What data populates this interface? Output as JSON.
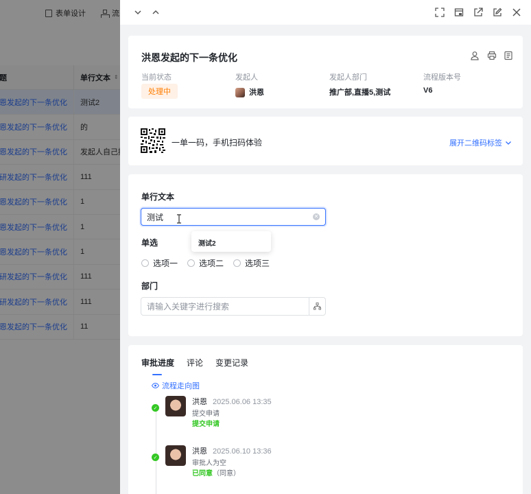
{
  "background": {
    "toolbar": {
      "form_design": "表单设计",
      "flow_partial": "流"
    },
    "table": {
      "col_title": "标题",
      "col_text": "单行文本",
      "rows": [
        {
          "title": "洪恩发起的下一条优化",
          "text": "测试2"
        },
        {
          "title": "洪恩发起的下一条优化",
          "text": "的"
        },
        {
          "title": "洪恩发起的下一条优化",
          "text": "发起人自己撤"
        },
        {
          "title": "钱研发起的下一条优化",
          "text": "111"
        },
        {
          "title": "洪恩发起的下一条优化",
          "text": "1"
        },
        {
          "title": "洪恩发起的下一条优化",
          "text": "1"
        },
        {
          "title": "洪恩发起的下一条优化",
          "text": "1"
        },
        {
          "title": "钱研发起的下一条优化",
          "text": "111"
        },
        {
          "title": "钱研发起的下一条优化",
          "text": "111"
        },
        {
          "title": "洪恩发起的下一条优化",
          "text": "11"
        }
      ]
    }
  },
  "header": {
    "title": "洪恩发起的下一条优化",
    "labels": {
      "status": "当前状态",
      "initiator": "发起人",
      "dept": "发起人部门",
      "version": "流程版本号"
    },
    "status": "处理中",
    "initiator": "洪恩",
    "dept": "推广部,直播5,测试",
    "version": "V6"
  },
  "qr": {
    "text": "一单一码，手机扫码体验",
    "expand_label": "展开二维码标签"
  },
  "form": {
    "text_label": "单行文本",
    "text_value": "测试",
    "suggestion": "测试2",
    "radio_label": "单选",
    "options": [
      "选项一",
      "选项二",
      "选项三"
    ],
    "dept_label": "部门",
    "dept_placeholder": "请输入关键字进行搜索"
  },
  "approval": {
    "tabs": [
      "审批进度",
      "评论",
      "变更记录"
    ],
    "flow_link": "流程走向图",
    "records": [
      {
        "name": "洪恩",
        "time": "2025.06.06 13:35",
        "desc": "提交申请",
        "result": "提交申请",
        "result_sub": ""
      },
      {
        "name": "洪恩",
        "time": "2025.06.10 13:36",
        "desc": "审批人为空",
        "result": "已同意",
        "result_sub": "（同意）"
      }
    ]
  },
  "colors": {
    "accent": "#3370ff",
    "status_orange": "#ff7d00",
    "success_green": "#34c724"
  }
}
